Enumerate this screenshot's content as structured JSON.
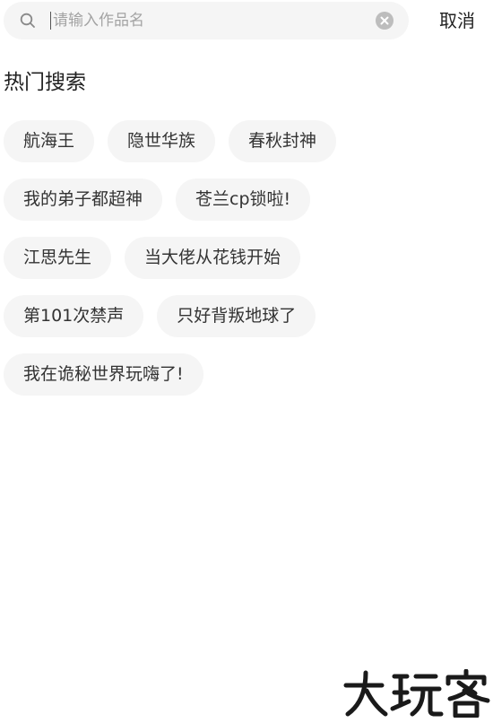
{
  "search": {
    "placeholder": "请输入作品名",
    "value": "",
    "cancel_label": "取消"
  },
  "hot_search": {
    "title": "热门搜索",
    "tags": [
      "航海王",
      "隐世华族",
      "春秋封神",
      "我的弟子都超神",
      "苍兰cp锁啦!",
      "江思先生",
      "当大佬从花钱开始",
      "第101次禁声",
      "只好背叛地球了",
      "我在诡秘世界玩嗨了!"
    ]
  },
  "watermark": {
    "text": "大玩客"
  },
  "colors": {
    "tag_background": "#f5f5f5",
    "placeholder": "#a3a3a3",
    "text": "#333333"
  }
}
